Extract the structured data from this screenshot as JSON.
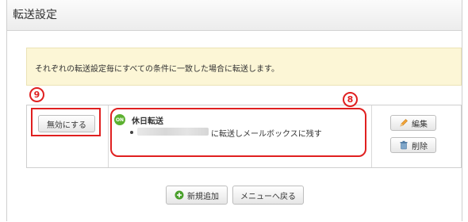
{
  "page": {
    "title": "転送設定",
    "notice": "それぞれの転送設定毎にすべての条件に一致した場合に転送します。"
  },
  "rule": {
    "disable_button": "無効にする",
    "badge_text": "ON",
    "title": "休日転送",
    "detail_suffix": "に転送しメールボックスに残す",
    "edit_button": "編集",
    "delete_button": "削除"
  },
  "annotations": {
    "marker_9": "9",
    "marker_8": "8"
  },
  "footer": {
    "add_button": "新規追加",
    "back_button": "メニューへ戻る"
  },
  "colors": {
    "accent_red": "#e02020",
    "on_badge_green": "#5cb130",
    "notice_bg": "#fcf6d6"
  }
}
